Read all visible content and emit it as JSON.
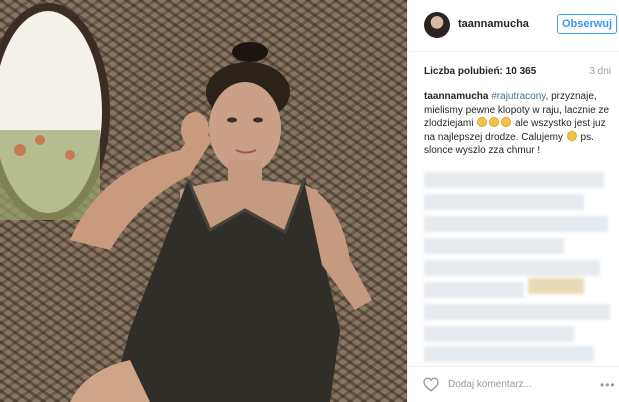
{
  "post": {
    "username": "taannamucha",
    "follow_label": "Obserwuj",
    "likes_text": "Liczba polubień: 10 365",
    "time_ago": "3 dni",
    "caption": {
      "user": "taannamucha",
      "hashtag": "#rajutracony",
      "text_1": ", przyznaje, mielismy pewne klopoty w raju, lacznie ze zlodziejami",
      "text_2": "ale wszystko jest juz na najlepszej drodze. Calujemy",
      "text_3": "ps. slonce wyszlo zza chmur !"
    },
    "comment_placeholder": "Dodaj komentarz...",
    "more_label": "•••"
  },
  "icons": {
    "heart": "heart-icon",
    "more": "more-options-icon",
    "emoji": "emoji-icon"
  },
  "colors": {
    "accent": "#3897f0",
    "hashtag": "#3f729b"
  }
}
